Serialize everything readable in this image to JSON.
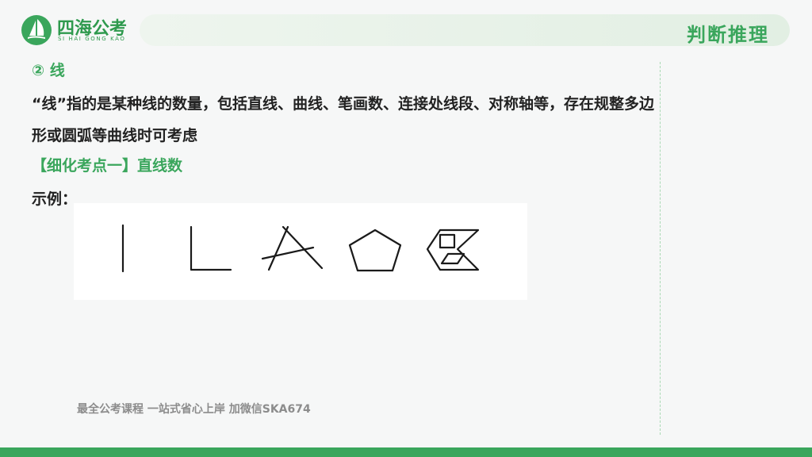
{
  "logo": {
    "name": "四海公考",
    "subtitle": "SI HAI GONG KAO"
  },
  "header": {
    "section_title": "判断推理"
  },
  "content": {
    "heading": "② 线",
    "paragraph": "“线”指的是某种线的数量，包括直线、曲线、笔画数、连接处线段、对称轴等，存在规整多边形或圆弧等曲线时可考虑",
    "sub_heading": "【细化考点一】直线数",
    "example_label": "示例："
  },
  "figure": {
    "shapes": [
      "vertical-line",
      "right-angle",
      "crossed-lines",
      "pentagon",
      "composite-shape"
    ]
  },
  "footer": {
    "promo": "最全公考课程 一站式省心上岸 加微信SKA674"
  },
  "colors": {
    "accent": "#3aa65c",
    "text": "#222222",
    "promo": "#8c8c8c"
  }
}
